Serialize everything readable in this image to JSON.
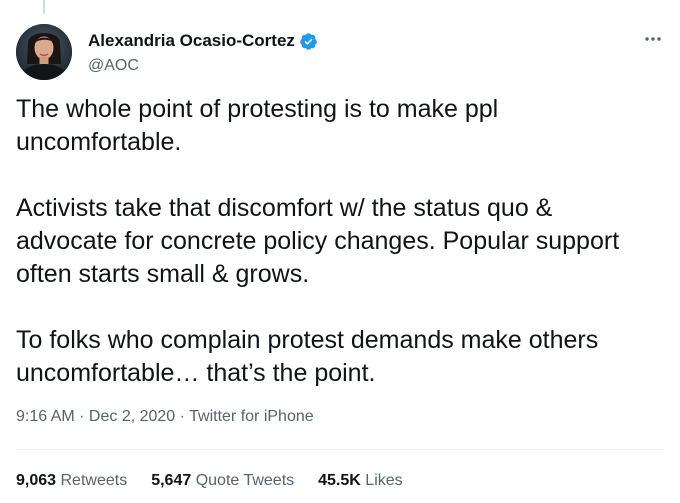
{
  "tweet": {
    "author": {
      "display_name": "Alexandria Ocasio-Cortez",
      "handle": "@AOC",
      "verified": true
    },
    "text": "The whole point of protesting is to make ppl\nuncomfortable.\n\nActivists take that discomfort w/ the status quo &\nadvocate for concrete policy changes. Popular support\noften starts small & grows.\n\nTo folks who complain protest demands make others\nuncomfortable… that’s the point.",
    "time": "9:16 AM",
    "date": "Dec 2, 2020",
    "source": "Twitter for iPhone",
    "separator": " · "
  },
  "stats": [
    {
      "value": "9,063",
      "label": "Retweets"
    },
    {
      "value": "5,647",
      "label": "Quote Tweets"
    },
    {
      "value": "45.5K",
      "label": "Likes"
    }
  ],
  "icons": {
    "verified": "verified-badge-icon",
    "more": "more-options-icon"
  },
  "colors": {
    "text_primary": "#0f1419",
    "text_secondary": "#536471",
    "verified_blue": "#1d9bf0",
    "divider": "#eff3f4"
  }
}
